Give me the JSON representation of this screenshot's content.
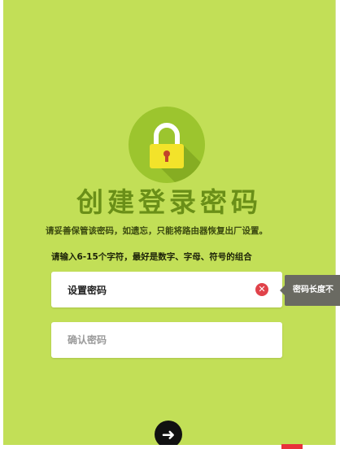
{
  "page": {
    "title": "创建登录密码",
    "subtitle": "请妥善保管该密码，如遗忘，只能将路由器恢复出厂设置。",
    "hint": "请输入6-15个字符，最好是数字、字母、符号的组合"
  },
  "form": {
    "password_value": "设置密码",
    "confirm_placeholder": "确认密码"
  },
  "tooltip": {
    "text": "密码长度不"
  },
  "icons": {
    "lock": "lock-icon",
    "clear": "clear-icon",
    "next": "arrow-right-icon"
  },
  "colors": {
    "background": "#c2df57",
    "accent_dark": "#6a8f18",
    "lock_body": "#f3e32a",
    "error": "#e0424a"
  },
  "glyphs": {
    "clear": "✕",
    "next": "➜"
  }
}
